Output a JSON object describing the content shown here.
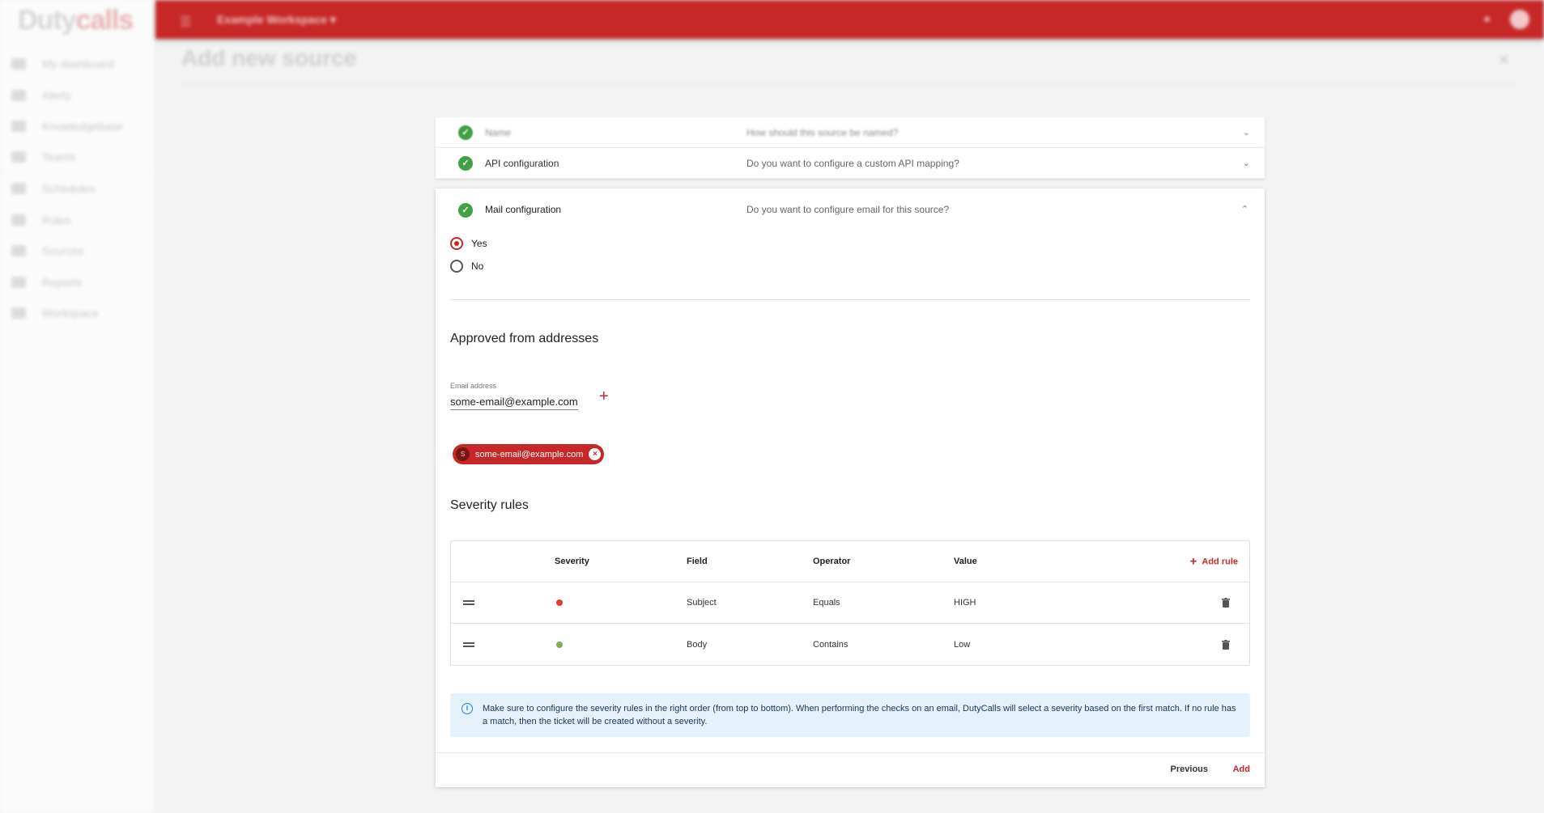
{
  "app": {
    "logo_main": "Duty",
    "logo_accent": "calls",
    "workspace": "Example Workspace ▾"
  },
  "sidebar": {
    "items": [
      {
        "label": "My dashboard"
      },
      {
        "label": "Alerts"
      },
      {
        "label": "Knowledgebase"
      },
      {
        "label": "Teams"
      },
      {
        "label": "Schedules"
      },
      {
        "label": "Rules"
      },
      {
        "label": "Sources"
      },
      {
        "label": "Reports"
      },
      {
        "label": "Workspace"
      }
    ]
  },
  "page": {
    "title": "Add new source"
  },
  "steps": [
    {
      "title": "Name",
      "description": "How should this source be named?"
    },
    {
      "title": "API configuration",
      "description": "Do you want to configure a custom API mapping?"
    },
    {
      "title": "Mail configuration",
      "description": "Do you want to configure email for this source?"
    }
  ],
  "mail": {
    "options": {
      "yes": "Yes",
      "no": "No",
      "selected": "yes"
    },
    "approved_title": "Approved from addresses",
    "email_label": "Email address",
    "email_value": "some-email@example.com",
    "chip": {
      "avatar": "S",
      "label": "some-email@example.com"
    },
    "severity_title": "Severity rules",
    "table": {
      "headers": {
        "severity": "Severity",
        "field": "Field",
        "operator": "Operator",
        "value": "Value",
        "add_rule": "Add rule"
      },
      "rows": [
        {
          "severity_color": "#e53935",
          "field": "Subject",
          "operator": "Equals",
          "value": "HIGH"
        },
        {
          "severity_color": "#7cb342",
          "field": "Body",
          "operator": "Contains",
          "value": "Low"
        }
      ]
    },
    "info": "Make sure to configure the severity rules in the right order (from top to bottom). When performing the checks on an email, DutyCalls will select a severity based on the first match. If no rule has a match, then the ticket will be created without a severity."
  },
  "actions": {
    "previous": "Previous",
    "add": "Add"
  },
  "colors": {
    "brand": "#c62828",
    "success": "#43a047",
    "info_bg": "#e6f2fb"
  }
}
